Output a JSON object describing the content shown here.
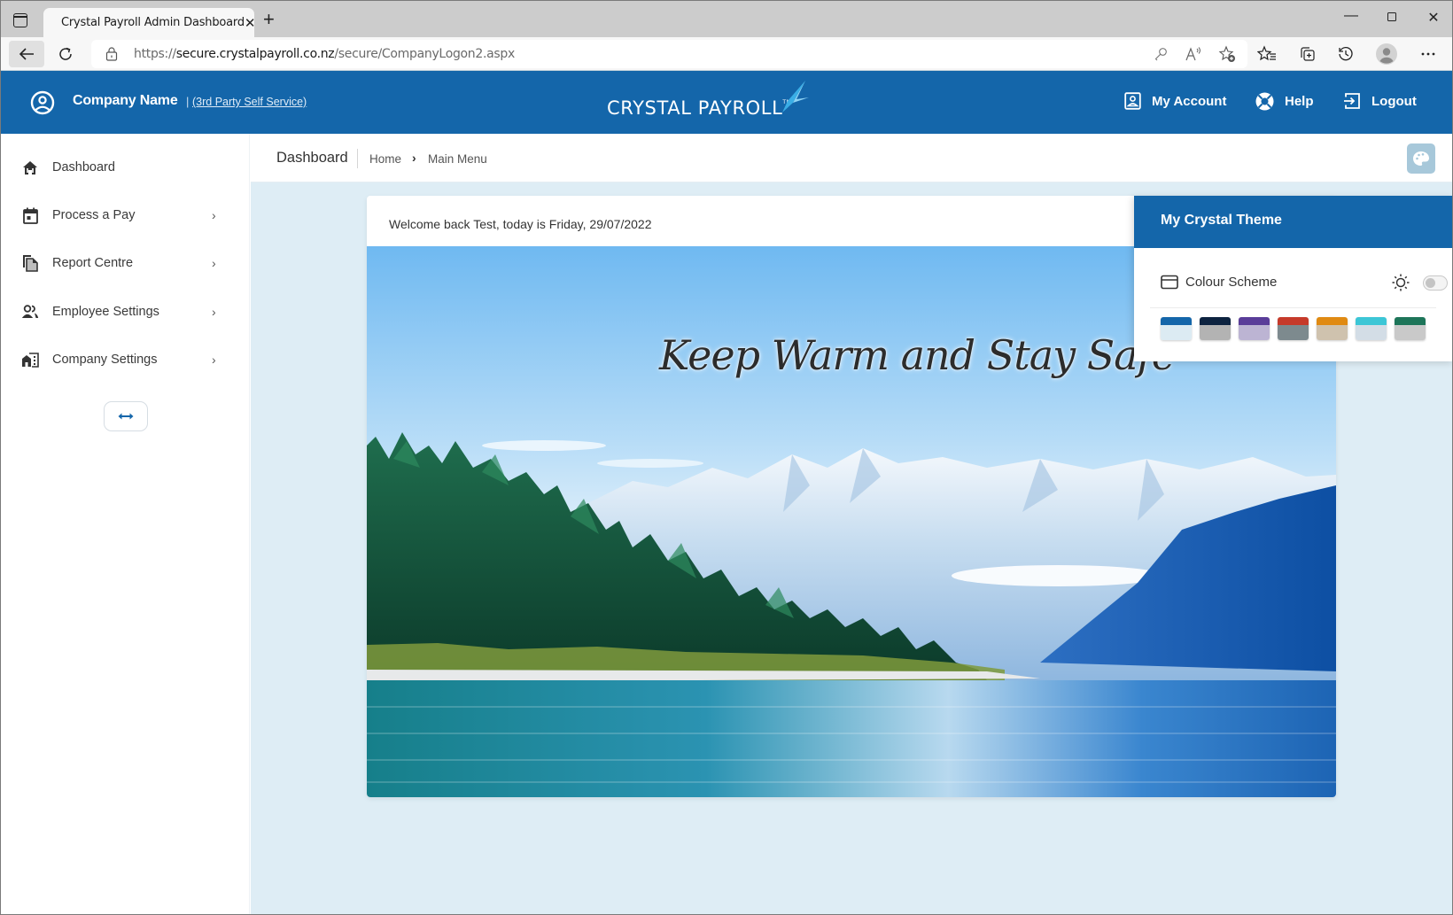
{
  "browser": {
    "tab_title": "Crystal Payroll Admin Dashboard",
    "tab_close": "✕",
    "new_tab": "+",
    "url_prefix": "https://",
    "url_domain": "secure.crystalpayroll.co.nz",
    "url_path": "/secure/CompanyLogon2.aspx",
    "window_controls": {
      "minimize": "—",
      "close": "✕"
    },
    "toolbar_icons": [
      "back-icon",
      "reload-icon",
      "lock-icon",
      "password-key-icon",
      "read-aloud-icon",
      "add-favorite-icon",
      "favorites-icon",
      "collections-icon",
      "history-icon",
      "profile-icon",
      "more-icon"
    ]
  },
  "header": {
    "company_name": "Company Name",
    "separator": "|",
    "self_service_link": "(3rd Party Self Service)",
    "logo_text": "CRYSTAL PAYROLL",
    "logo_tm": "TM",
    "brand_color": "#1466aa",
    "links": {
      "account": "My Account",
      "help": "Help",
      "logout": "Logout"
    }
  },
  "sidebar": {
    "items": [
      {
        "label": "Dashboard",
        "icon": "home-icon",
        "has_submenu": false
      },
      {
        "label": "Process a Pay",
        "icon": "calendar-icon",
        "has_submenu": true
      },
      {
        "label": "Report Centre",
        "icon": "documents-icon",
        "has_submenu": true
      },
      {
        "label": "Employee Settings",
        "icon": "people-icon",
        "has_submenu": true
      },
      {
        "label": "Company Settings",
        "icon": "building-icon",
        "has_submenu": true
      }
    ],
    "chevron": "›",
    "collapse_icon": "↔"
  },
  "breadcrumb": {
    "title": "Dashboard",
    "home": "Home",
    "chevron": "›",
    "current": "Main Menu"
  },
  "dashboard": {
    "welcome": "Welcome back Test, today is Friday, 29/07/2022",
    "banner_text": "Keep Warm and Stay Safe"
  },
  "theme_panel": {
    "title": "My Crystal Theme",
    "colour_scheme_label": "Colour Scheme",
    "dark_mode_enabled": false,
    "swatches": [
      {
        "name": "blue",
        "top": "#1466aa",
        "bottom": "#dcebf3"
      },
      {
        "name": "navy",
        "top": "#0d2340",
        "bottom": "#b3b3b3"
      },
      {
        "name": "purple",
        "top": "#5a3d99",
        "bottom": "#bcb4d3"
      },
      {
        "name": "red",
        "top": "#c63a2a",
        "bottom": "#7d8a8e"
      },
      {
        "name": "orange",
        "top": "#e08a12",
        "bottom": "#cfc2ae"
      },
      {
        "name": "cyan",
        "top": "#3cc6d6",
        "bottom": "#d3dde6"
      },
      {
        "name": "green",
        "top": "#1d7559",
        "bottom": "#c9c9c9"
      }
    ]
  }
}
